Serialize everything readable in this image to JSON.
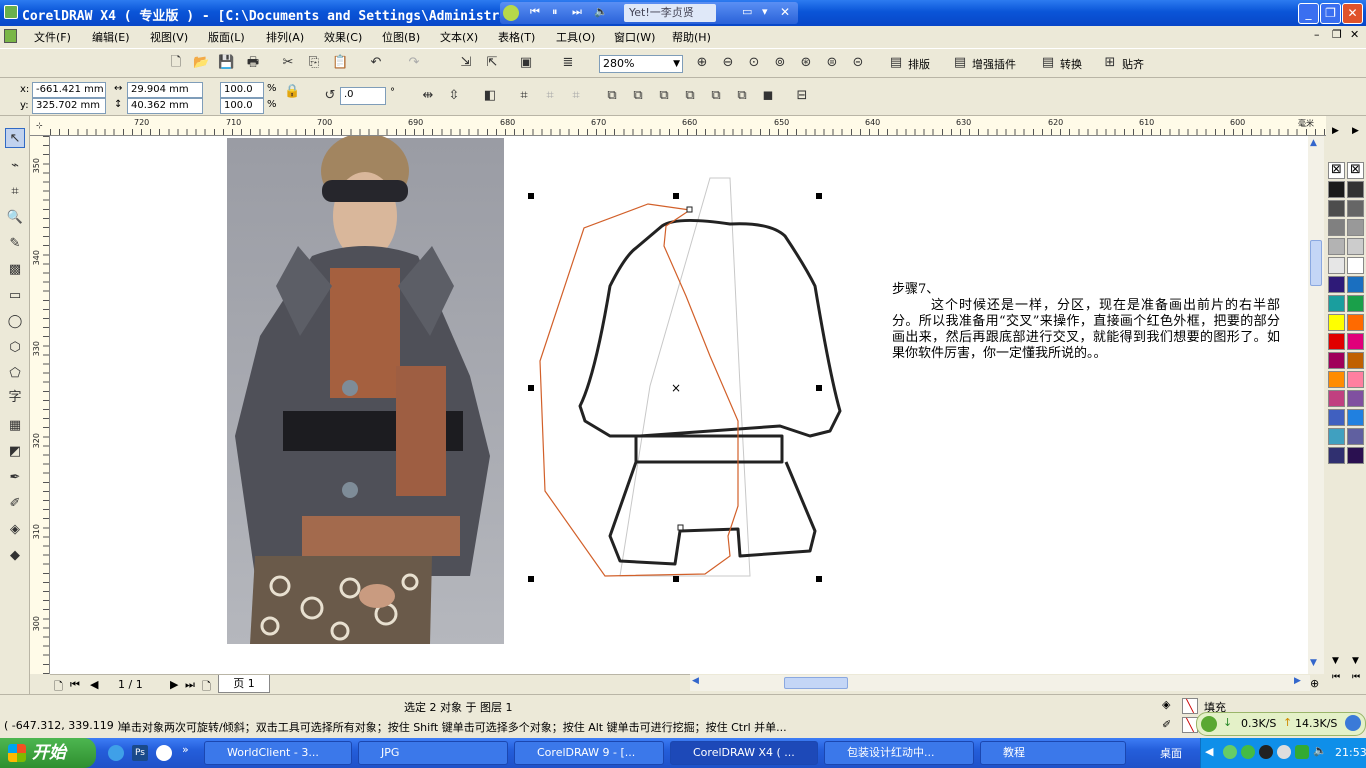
{
  "window": {
    "title": "CorelDRAW X4 ( 专业版 ) - [C:\\Documents and Settings\\Administrator\\...",
    "media_track": "Yet!一李贞贤"
  },
  "menu": [
    "文件(F)",
    "编辑(E)",
    "视图(V)",
    "版面(L)",
    "排列(A)",
    "效果(C)",
    "位图(B)",
    "文本(X)",
    "表格(T)",
    "工具(O)",
    "窗口(W)",
    "帮助(H)"
  ],
  "toolbar": {
    "zoom": "280%",
    "plugins": [
      "排版",
      "增强插件",
      "转换",
      "贴齐"
    ]
  },
  "property_bar": {
    "x_label": "x:",
    "x": "-661.421 mm",
    "y_label": "y:",
    "y": "325.702 mm",
    "width": "29.904 mm",
    "height": "40.362 mm",
    "scale_w": "100.0",
    "scale_h": "100.0",
    "pct1": "%",
    "pct2": "%",
    "rotation": ".0",
    "deg": "°"
  },
  "ruler": {
    "top_ticks": [
      "720",
      "710",
      "700",
      "690",
      "680",
      "670",
      "660",
      "650",
      "640",
      "630",
      "620",
      "610",
      "600"
    ],
    "unit": "毫米",
    "left_ticks": [
      "350",
      "340",
      "330",
      "320",
      "310",
      "300"
    ]
  },
  "note": {
    "heading": "步骤7、",
    "body": "这个时候还是一样，分区，现在是准备画出前片的右半部分。所以我准备用“交叉”来操作，直接画个红色外框，把要的部分画出来，然后再跟底部进行交叉，就能得到我们想要的图形了。如果你软件厉害，你一定懂我所说的。。"
  },
  "pagebar": {
    "page_count": "1 / 1",
    "page_tab": "页 1"
  },
  "status": {
    "selection": "选定 2 对象 于 图层 1",
    "coords": "( -647.312, 339.119 )",
    "hint": "单击对象两次可旋转/倾斜；双击工具可选择所有对象；按住 Shift 键单击可选择多个对象；按住 Alt 键单击可进行挖掘；按住 Ctrl 并单...",
    "fill_label": "填充"
  },
  "net": {
    "down": "0.3K/S",
    "up": "14.3K/S"
  },
  "taskbar": {
    "start": "开始",
    "tasks": [
      "WorldClient - 3...",
      "JPG",
      "CorelDRAW 9 - [...",
      "CorelDRAW X4 ( ...",
      "包装设计红动中...",
      "教程"
    ],
    "desktop": "桌面",
    "clock": "21:53"
  },
  "colors": {
    "titlebar": "#0a55d8",
    "taskbar": "#245edb",
    "start": "#3c9b3c",
    "outline_red": "#d2602a"
  },
  "palette": [
    "#1a1a1a",
    "#333333",
    "#4d4d4d",
    "#666666",
    "#808080",
    "#999999",
    "#b3b3b3",
    "#cccccc",
    "#e6e6e6",
    "#ffffff",
    "#2e1a78",
    "#1a6fc0",
    "#1a9e9e",
    "#1aa04a",
    "#ffff00",
    "#ff6a00",
    "#e00000",
    "#e0007a",
    "#a0005a",
    "#c06000",
    "#ff8c00",
    "#ff7fa0",
    "#c04080",
    "#8050a0",
    "#4060c0",
    "#2080e0",
    "#40a0c0",
    "#6060a0",
    "#303070",
    "#2a1050"
  ]
}
